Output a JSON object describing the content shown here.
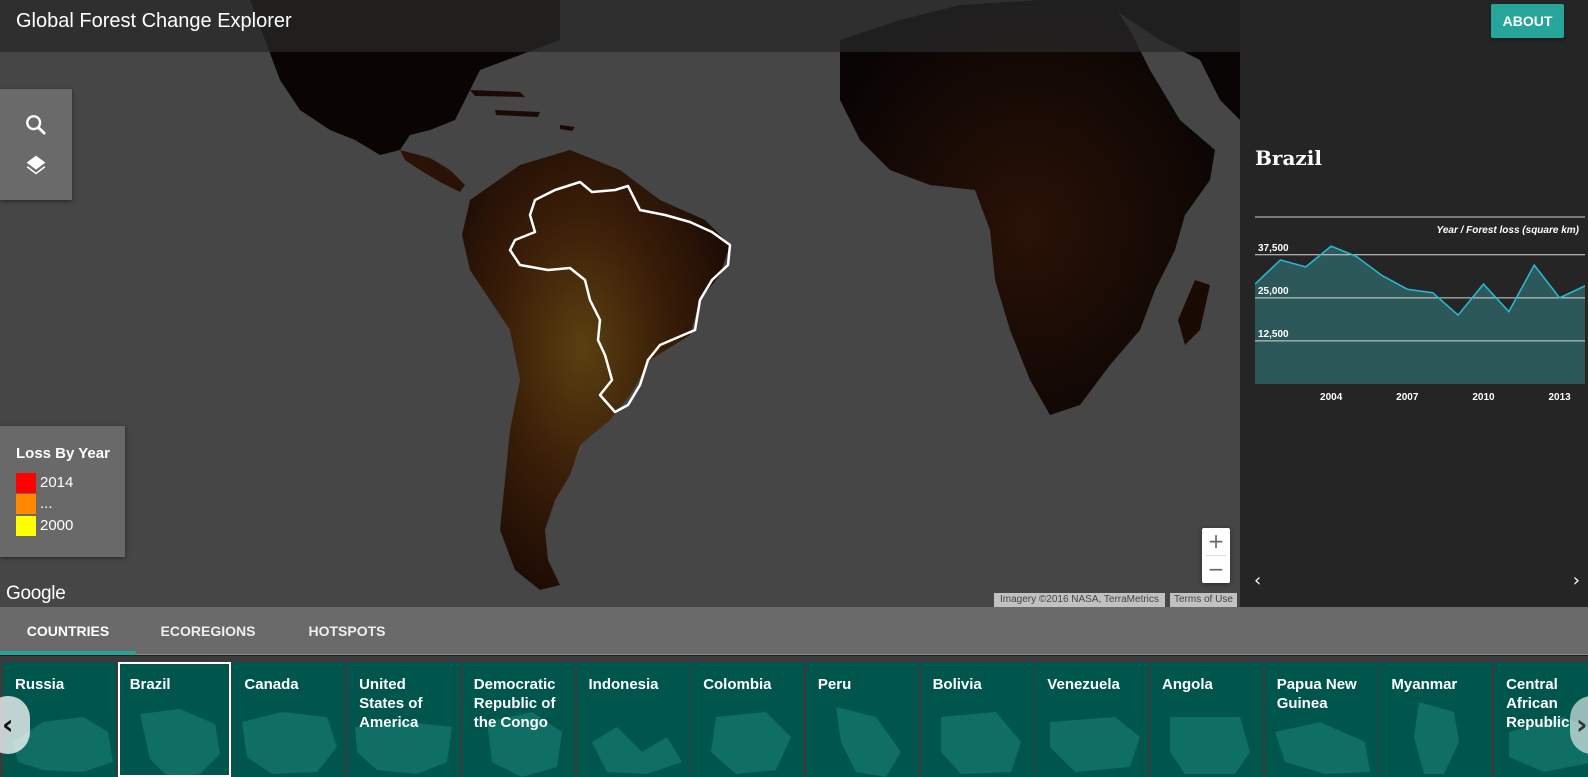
{
  "header": {
    "title": "Global Forest Change Explorer",
    "about_label": "ABOUT"
  },
  "toolbar": {
    "search_icon": "search-icon",
    "layers_icon": "layers-icon"
  },
  "legend": {
    "title": "Loss By Year",
    "items": [
      {
        "label": "2014",
        "color": "#ff0000"
      },
      {
        "label": "...",
        "color": "#ff8800"
      },
      {
        "label": "2000",
        "color": "#ffff00"
      }
    ]
  },
  "map": {
    "zoom_in": "+",
    "zoom_out": "−",
    "logo": "Google",
    "imagery": "Imagery ©2016 NASA, TerraMetrics",
    "terms": "Terms of Use",
    "land_color": "#050303",
    "water_color": "#464646",
    "selected_region": "Brazil"
  },
  "panel": {
    "title": "Brazil",
    "prev_icon": "chevron-left-icon",
    "next_icon": "chevron-right-icon"
  },
  "chart_data": {
    "type": "area",
    "title": "Year / Forest loss (square km)",
    "x": [
      2001,
      2002,
      2003,
      2004,
      2005,
      2006,
      2007,
      2008,
      2009,
      2010,
      2011,
      2012,
      2013,
      2014
    ],
    "values": [
      29000,
      36000,
      34000,
      40000,
      37000,
      31500,
      27500,
      26500,
      20000,
      29000,
      21000,
      34500,
      25000,
      28500
    ],
    "x_tick_labels": [
      "2004",
      "2007",
      "2010",
      "2013"
    ],
    "y_tick_labels": [
      "12,500",
      "25,000",
      "37,500"
    ],
    "y_ticks": [
      12500,
      25000,
      37500
    ],
    "ylim": [
      0,
      50000
    ],
    "grid": true,
    "line_color": "#29b6d0",
    "fill_color": "#2c5859"
  },
  "tabs": [
    {
      "label": "COUNTRIES",
      "active": true
    },
    {
      "label": "ECOREGIONS",
      "active": false
    },
    {
      "label": "HOTSPOTS",
      "active": false
    }
  ],
  "countries": [
    {
      "label": "Russia",
      "selected": false
    },
    {
      "label": "Brazil",
      "selected": true
    },
    {
      "label": "Canada",
      "selected": false
    },
    {
      "label": "United States of America",
      "selected": false
    },
    {
      "label": "Democratic Republic of the Congo",
      "selected": false
    },
    {
      "label": "Indonesia",
      "selected": false
    },
    {
      "label": "Colombia",
      "selected": false
    },
    {
      "label": "Peru",
      "selected": false
    },
    {
      "label": "Bolivia",
      "selected": false
    },
    {
      "label": "Venezuela",
      "selected": false
    },
    {
      "label": "Angola",
      "selected": false
    },
    {
      "label": "Papua New Guinea",
      "selected": false
    },
    {
      "label": "Myanmar",
      "selected": false
    },
    {
      "label": "Central African Republic",
      "selected": false
    }
  ],
  "carousel": {
    "prev_icon": "chevron-left-icon",
    "next_icon": "chevron-right-icon"
  }
}
